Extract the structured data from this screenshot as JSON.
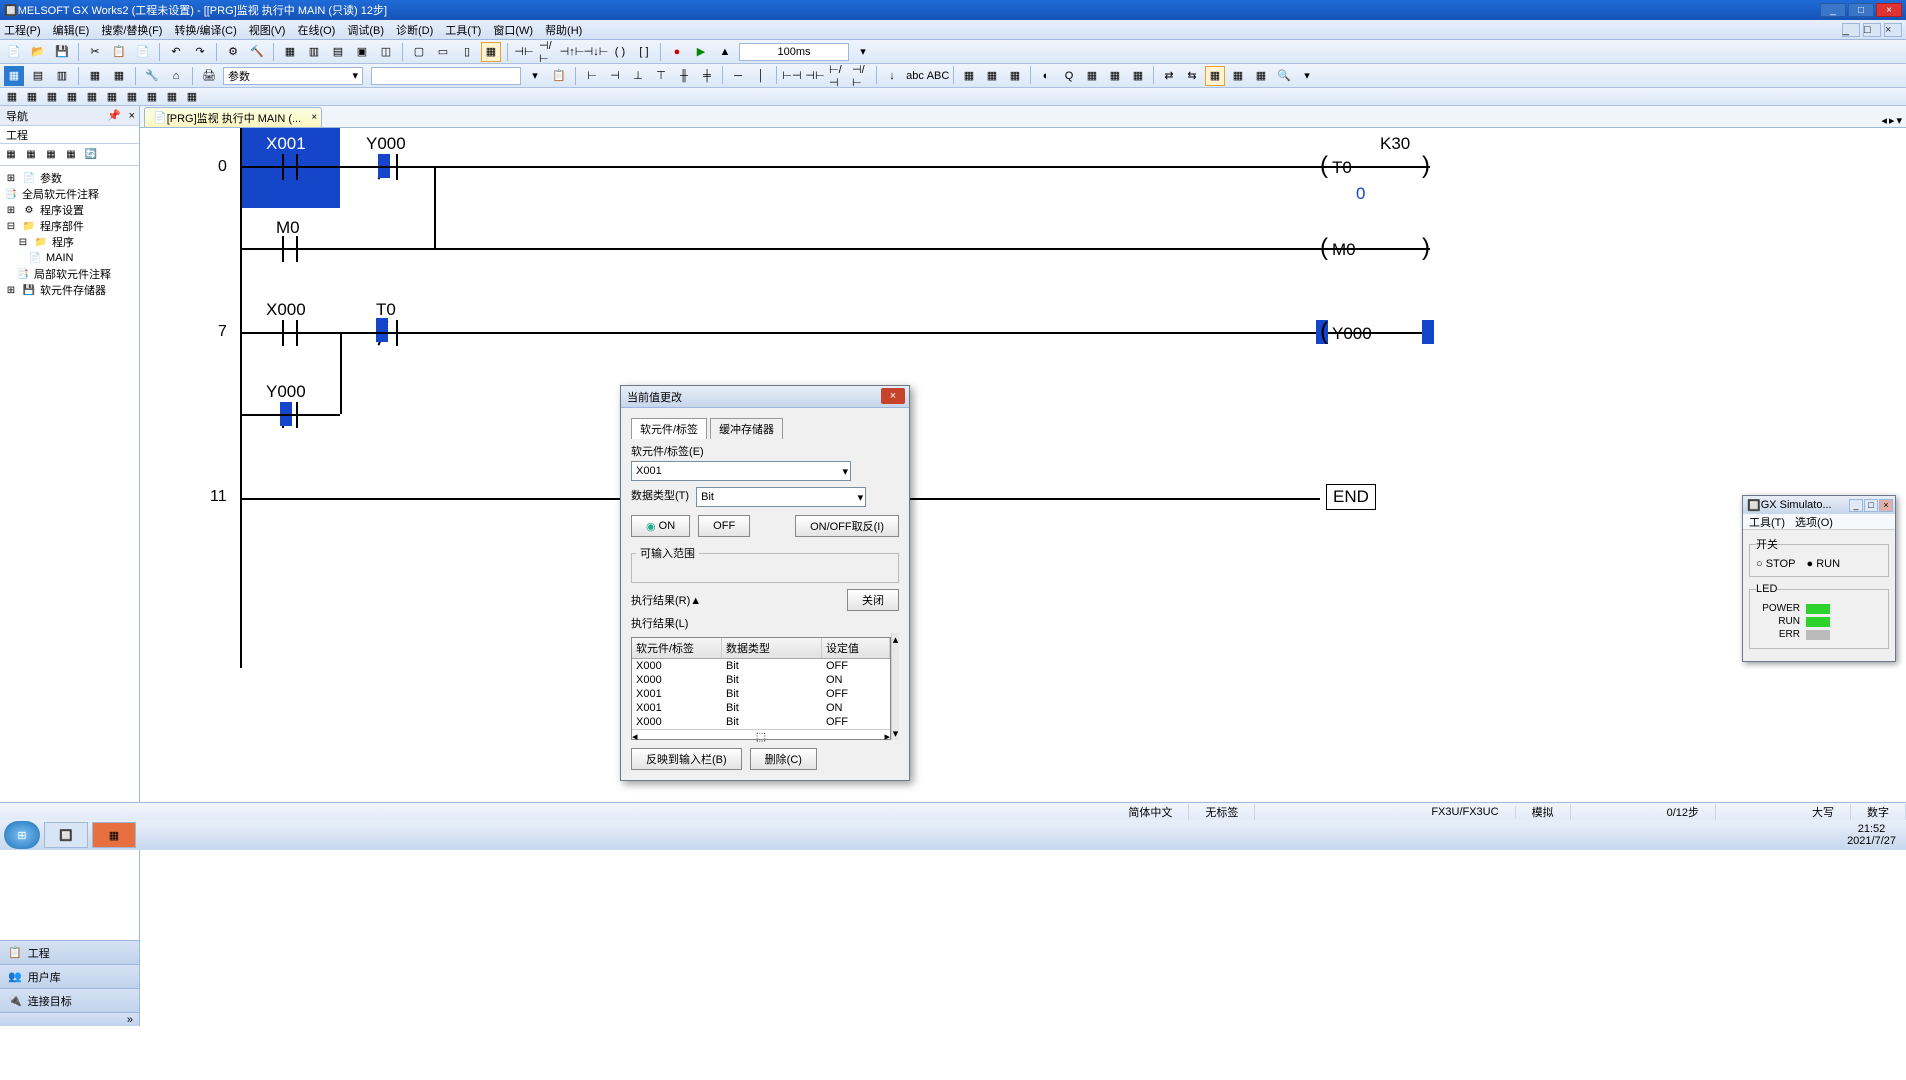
{
  "title": "MELSOFT GX Works2 (工程未设置) - [[PRG]监视 执行中 MAIN (只读) 12步]",
  "menubar": [
    "工程(P)",
    "编辑(E)",
    "搜索/替换(F)",
    "转换/编译(C)",
    "视图(V)",
    "在线(O)",
    "调试(B)",
    "诊断(D)",
    "工具(T)",
    "窗口(W)",
    "帮助(H)"
  ],
  "zoom": "100ms",
  "toolbar2": {
    "combo": "参数"
  },
  "nav": {
    "title": "导航",
    "section": "工程",
    "items": [
      {
        "l": 0,
        "icon": "📄",
        "label": "参数"
      },
      {
        "l": 0,
        "icon": "📑",
        "label": "全局软元件注释"
      },
      {
        "l": 0,
        "icon": "⚙",
        "label": "程序设置"
      },
      {
        "l": 0,
        "icon": "📁",
        "label": "程序部件"
      },
      {
        "l": 1,
        "icon": "📁",
        "label": "程序"
      },
      {
        "l": 2,
        "icon": "📄",
        "label": "MAIN"
      },
      {
        "l": 1,
        "icon": "📑",
        "label": "局部软元件注释"
      },
      {
        "l": 0,
        "icon": "💾",
        "label": "软元件存储器"
      }
    ],
    "foot": [
      {
        "icon": "📋",
        "label": "工程"
      },
      {
        "icon": "👥",
        "label": "用户库"
      },
      {
        "icon": "🔌",
        "label": "连接目标"
      }
    ]
  },
  "tab": {
    "label": "[PRG]监视 执行中 MAIN (...",
    "icon": "📄"
  },
  "ladder": {
    "r0": "0",
    "r7": "7",
    "r11": "11",
    "x001": "X001",
    "y000": "Y000",
    "m0": "M0",
    "x000": "X000",
    "t0": "T0",
    "y000b": "Y000",
    "k30": "K30",
    "coil_t0": "T0",
    "val_t0": "0",
    "coil_m0": "M0",
    "coil_y000": "Y000",
    "end": "END"
  },
  "dialog": {
    "title": "当前值更改",
    "tab1": "软元件/标签",
    "tab2": "缓冲存储器",
    "lbl_dev": "软元件/标签(E)",
    "val_dev": "X001",
    "lbl_type": "数据类型(T)",
    "val_type": "Bit",
    "btn_on": "ON",
    "btn_off": "OFF",
    "btn_toggle": "ON/OFF取反(I)",
    "fset_range": "可输入范围",
    "lbl_result": "执行结果(R)▲",
    "btn_close": "关闭",
    "lbl_list": "执行结果(L)",
    "hdr": [
      "软元件/标签",
      "数据类型",
      "设定值"
    ],
    "rows": [
      [
        "X000",
        "Bit",
        "OFF"
      ],
      [
        "X000",
        "Bit",
        "ON"
      ],
      [
        "X001",
        "Bit",
        "OFF"
      ],
      [
        "X001",
        "Bit",
        "ON"
      ],
      [
        "X000",
        "Bit",
        "OFF"
      ]
    ],
    "btn_reflect": "反映到输入栏(B)",
    "btn_delete": "删除(C)"
  },
  "sim": {
    "title": "GX Simulato...",
    "menu": [
      "工具(T)",
      "选项(O)"
    ],
    "sw": "开关",
    "stop": "STOP",
    "run": "RUN",
    "led": "LED",
    "power": "POWER",
    "runled": "RUN",
    "err": "ERR"
  },
  "status": {
    "lang": "简体中文",
    "tag": "无标签",
    "cpu": "FX3U/FX3UC",
    "mode": "模拟",
    "steps": "0/12步",
    "caps": "大写",
    "num": "数字"
  },
  "clock": {
    "time": "21:52",
    "date": "2021/7/27"
  }
}
